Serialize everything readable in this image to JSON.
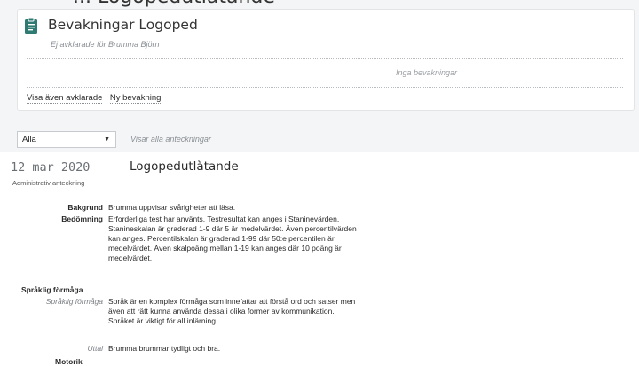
{
  "header_cut_text": "... Logopedutlåtande",
  "monitoring_panel": {
    "icon": "clipboard-icon",
    "title": "Bevakningar Logoped",
    "subtitle": "Ej avklarade för Brumma Björn",
    "empty_message": "Inga bevakningar",
    "link_show_completed": "Visa även avklarade",
    "link_separator": "|",
    "link_new": "Ny bevakning"
  },
  "filter": {
    "selected": "Alla",
    "status": "Visar alla anteckningar"
  },
  "note": {
    "date": "12 mar 2020",
    "title": "Logopedutlåtande",
    "type": "Administrativ anteckning",
    "fields": [
      {
        "label": "Bakgrund",
        "value": "Brumma uppvisar svårigheter att läsa."
      },
      {
        "label": "Bedömning",
        "value": "Erforderliga test har använts. Testresultat kan anges i Staninevärden. Stanineskalan är graderad 1-9 där 5 är medelvärdet. Även percentilvärden kan anges. Percentilskalan är graderad 1-99 där 50:e percentilen är medelvärdet. Även skalpoäng mellan 1-19 kan anges där 10 poäng är medelvärdet."
      }
    ],
    "section_language": "Språklig förmåga",
    "subfields": [
      {
        "label": "Språklig förmåga",
        "value": "Språk är en komplex förmåga som innefattar att förstå ord och satser men även att rätt kunna använda dessa i olika former av kommunikation. Språket är viktigt för all inlärning."
      },
      {
        "label": "Uttal",
        "value": "Brumma brummar tydligt och bra."
      }
    ],
    "next_label": "Motorik"
  },
  "colors": {
    "background": "#f4f5f6",
    "panel": "#ffffff",
    "muted_text": "#8a8f94"
  }
}
